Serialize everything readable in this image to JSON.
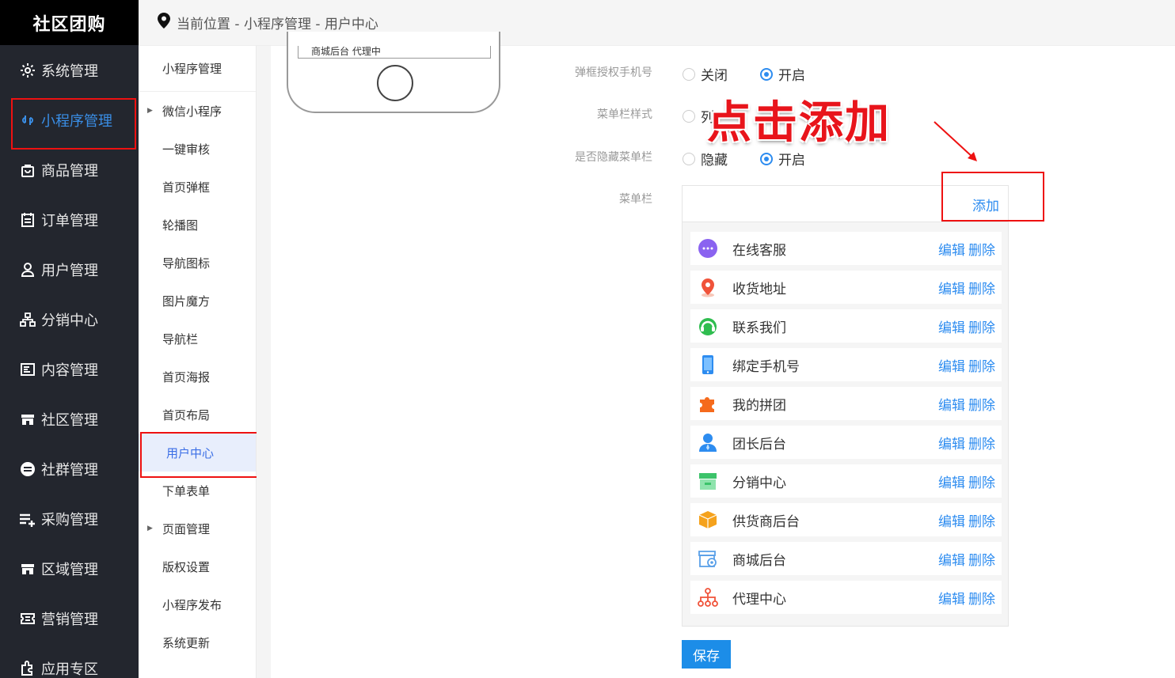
{
  "app": {
    "title": "社区团购"
  },
  "sidebar": {
    "items": [
      {
        "label": "系统管理",
        "icon": "gear-icon"
      },
      {
        "label": "小程序管理",
        "icon": "link-icon",
        "active": true
      },
      {
        "label": "商品管理",
        "icon": "bag-icon"
      },
      {
        "label": "订单管理",
        "icon": "calendar-icon"
      },
      {
        "label": "用户管理",
        "icon": "user-icon"
      },
      {
        "label": "分销中心",
        "icon": "org-icon"
      },
      {
        "label": "内容管理",
        "icon": "doc-icon"
      },
      {
        "label": "社区管理",
        "icon": "store-icon"
      },
      {
        "label": "社群管理",
        "icon": "minus-circle-icon"
      },
      {
        "label": "采购管理",
        "icon": "list-plus-icon"
      },
      {
        "label": "区域管理",
        "icon": "store-icon"
      },
      {
        "label": "营销管理",
        "icon": "ticket-icon"
      },
      {
        "label": "应用专区",
        "icon": "plugin-icon"
      }
    ]
  },
  "breadcrumb": {
    "text": "当前位置 - 小程序管理 - 用户中心"
  },
  "subnav": {
    "items": [
      {
        "label": "小程序管理"
      },
      {
        "label": "微信小程序",
        "arrow": true
      },
      {
        "label": "一键审核"
      },
      {
        "label": "首页弹框"
      },
      {
        "label": "轮播图"
      },
      {
        "label": "导航图标"
      },
      {
        "label": "图片魔方"
      },
      {
        "label": "导航栏"
      },
      {
        "label": "首页海报"
      },
      {
        "label": "首页布局"
      },
      {
        "label": "用户中心",
        "active": true
      },
      {
        "label": "下单表单"
      },
      {
        "label": "页面管理",
        "arrow": true
      },
      {
        "label": "版权设置"
      },
      {
        "label": "小程序发布"
      },
      {
        "label": "系统更新"
      }
    ]
  },
  "phone": {
    "screen_text": "商城后台   代理中"
  },
  "form": {
    "auth_phone": {
      "label": "弹框授权手机号",
      "off": "关闭",
      "on": "开启",
      "selected": "on"
    },
    "menu_style": {
      "label": "菜单栏样式",
      "opt1": "列"
    },
    "hide_menu": {
      "label": "是否隐藏菜单栏",
      "off": "隐藏",
      "on": "开启",
      "selected": "on"
    },
    "menu": {
      "label": "菜单栏",
      "add": "添加"
    }
  },
  "annotation": {
    "text": "点击添加"
  },
  "menu_items": [
    {
      "label": "在线客服",
      "icon": "chat-icon",
      "color": "#8a63f0"
    },
    {
      "label": "收货地址",
      "icon": "location-icon",
      "color": "#f0533a"
    },
    {
      "label": "联系我们",
      "icon": "headset-icon",
      "color": "#2fbd4f"
    },
    {
      "label": "绑定手机号",
      "icon": "phone-icon",
      "color": "#2d8cf0"
    },
    {
      "label": "我的拼团",
      "icon": "puzzle-icon",
      "color": "#f56a1c"
    },
    {
      "label": "团长后台",
      "icon": "leader-icon",
      "color": "#2d8cf0"
    },
    {
      "label": "分销中心",
      "icon": "shop-icon",
      "color": "#3cc36a"
    },
    {
      "label": "供货商后台",
      "icon": "box-icon",
      "color": "#f5a21c"
    },
    {
      "label": "商城后台",
      "icon": "mall-settings-icon",
      "color": "#5aa0e8"
    },
    {
      "label": "代理中心",
      "icon": "network-icon",
      "color": "#f0533a"
    }
  ],
  "actions": {
    "edit": "编辑",
    "delete": "删除"
  },
  "buttons": {
    "save": "保存"
  },
  "colors": {
    "accent": "#2d8cf0",
    "highlight": "#e11111",
    "sidebar_bg": "#23262e"
  }
}
